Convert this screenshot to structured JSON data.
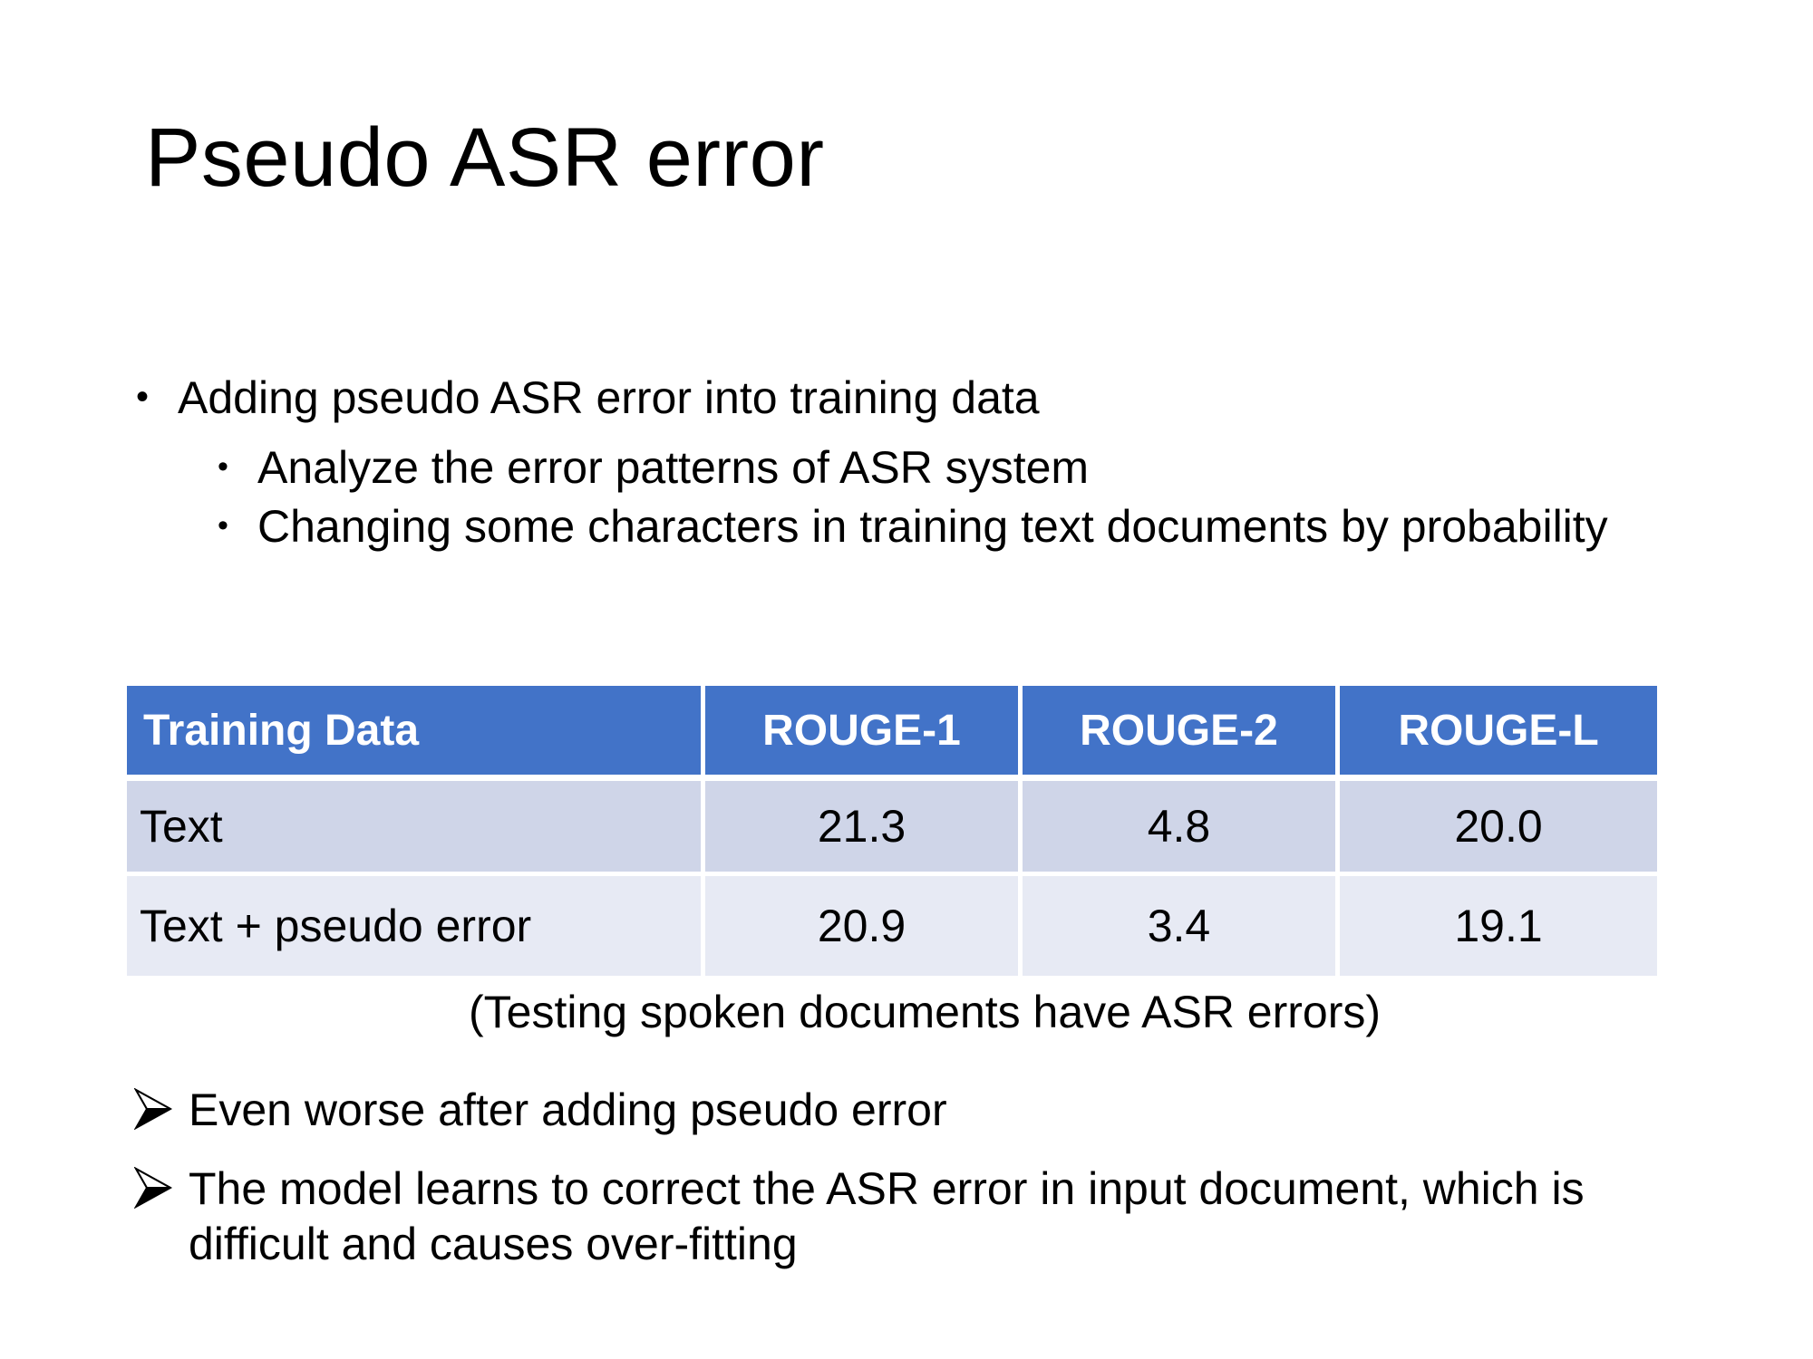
{
  "slide": {
    "title": "Pseudo ASR error"
  },
  "bullets": [
    {
      "level": 1,
      "marker": "•",
      "text": "Adding pseudo ASR error into training data"
    },
    {
      "level": 2,
      "marker": "•",
      "text": "Analyze the error patterns of ASR system"
    },
    {
      "level": 2,
      "marker": "•",
      "text": "Changing some characters in training text documents by probability"
    }
  ],
  "table": {
    "headers": [
      "Training Data",
      "ROUGE-1",
      "ROUGE-2",
      "ROUGE-L"
    ],
    "rows": [
      {
        "label": "Text",
        "rouge1": "21.3",
        "rouge2": "4.8",
        "rougeL": "20.0"
      },
      {
        "label": "Text + pseudo error",
        "rouge1": "20.9",
        "rouge2": "3.4",
        "rougeL": "19.1"
      }
    ],
    "caption": "(Testing spoken documents have ASR errors)",
    "colors": {
      "header_bg": "#4273C8",
      "header_text": "#FFFFFF",
      "row_a_bg": "#CFD5E8",
      "row_b_bg": "#E7EAF4",
      "grid": "#FFFFFF"
    }
  },
  "findings": [
    {
      "marker": "arrowhead-right-icon",
      "text": "Even worse after adding pseudo error"
    },
    {
      "marker": "arrowhead-right-icon",
      "text": "The model learns to correct the ASR error in input document, which is difficult and causes over-fitting"
    }
  ]
}
